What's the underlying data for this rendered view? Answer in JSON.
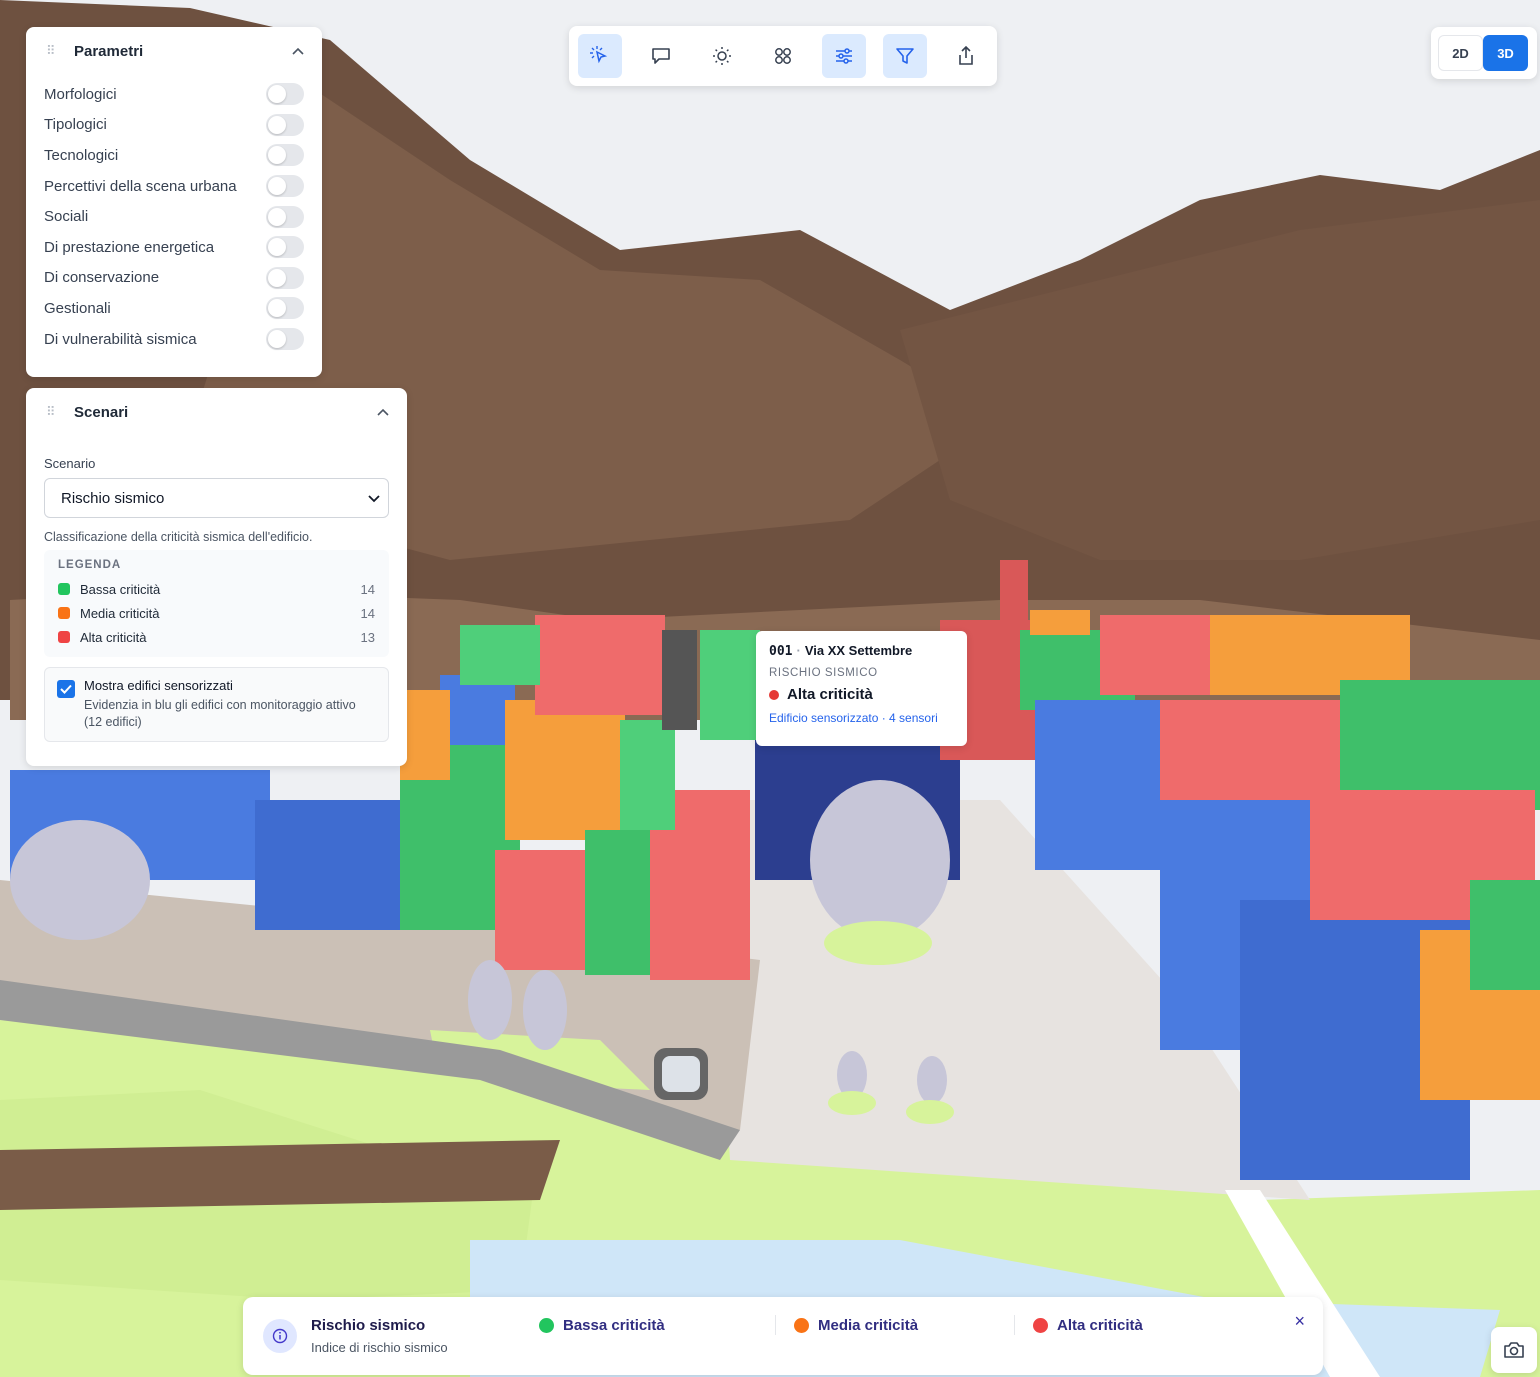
{
  "params": {
    "title": "Parametri",
    "items": [
      {
        "label": "Morfologici"
      },
      {
        "label": "Tipologici"
      },
      {
        "label": "Tecnologici"
      },
      {
        "label": "Percettivi della scena urbana"
      },
      {
        "label": "Sociali"
      },
      {
        "label": "Di prestazione energetica"
      },
      {
        "label": "Di conservazione"
      },
      {
        "label": "Gestionali"
      },
      {
        "label": "Di vulnerabilità sismica"
      }
    ]
  },
  "scenari": {
    "title": "Scenari",
    "scenario_label": "Scenario",
    "selected": "Rischio sismico",
    "description": "Classificazione della criticità sismica dell'edificio.",
    "legend_title": "LEGENDA",
    "legend": [
      {
        "label": "Bassa criticità",
        "count": "14",
        "color": "#22c55e"
      },
      {
        "label": "Media criticità",
        "count": "14",
        "color": "#f97316"
      },
      {
        "label": "Alta criticità",
        "count": "13",
        "color": "#ef4444"
      }
    ],
    "sensor_checked": true,
    "sensor_title": "Mostra edifici sensorizzati",
    "sensor_sub": "Evidenzia in blu gli edifici con monitoraggio attivo (12 edifici)"
  },
  "toolbar": {
    "tools": [
      {
        "icon": "select-pointer-icon",
        "active": true
      },
      {
        "icon": "comment-icon",
        "active": false
      },
      {
        "icon": "sun-icon",
        "active": false
      },
      {
        "icon": "grid-icon",
        "active": false
      },
      {
        "icon": "sliders-icon",
        "active": true
      },
      {
        "icon": "filter-icon",
        "active": true
      },
      {
        "icon": "share-icon",
        "active": false
      }
    ]
  },
  "viewmode": {
    "option_2d": "2D",
    "option_3d": "3D",
    "active": "3D"
  },
  "popup": {
    "code": "001",
    "address": "Via XX Settembre",
    "category": "RISCHIO SISMICO",
    "level": "Alta criticità",
    "sensor_text": "Edificio sensorizzato · 4 sensori"
  },
  "bottombar": {
    "title": "Rischio sismico",
    "subtitle": "Indice di rischio sismico",
    "items": [
      {
        "label": "Bassa criticità",
        "color": "#22c55e"
      },
      {
        "label": "Media criticità",
        "color": "#f97316"
      },
      {
        "label": "Alta criticità",
        "color": "#ef4444"
      }
    ],
    "close": "×"
  },
  "colors": {
    "accent": "#1a73e8",
    "sensorized": "#4a7be0",
    "terrain": "#7a5c48",
    "sky": "#eef0f3"
  }
}
